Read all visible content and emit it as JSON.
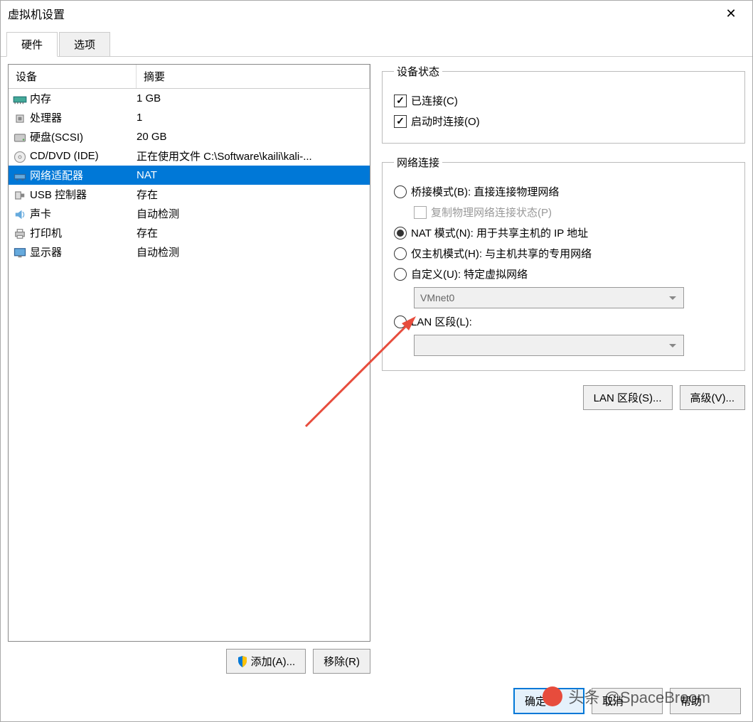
{
  "window": {
    "title": "虚拟机设置"
  },
  "tabs": {
    "hardware": "硬件",
    "options": "选项"
  },
  "list": {
    "header_device": "设备",
    "header_summary": "摘要",
    "rows": [
      {
        "icon": "memory-icon",
        "device": "内存",
        "summary": "1 GB"
      },
      {
        "icon": "cpu-icon",
        "device": "处理器",
        "summary": "1"
      },
      {
        "icon": "hdd-icon",
        "device": "硬盘(SCSI)",
        "summary": "20 GB"
      },
      {
        "icon": "cd-icon",
        "device": "CD/DVD (IDE)",
        "summary": "正在使用文件 C:\\Software\\kaili\\kali-..."
      },
      {
        "icon": "network-icon",
        "device": "网络适配器",
        "summary": "NAT",
        "selected": true
      },
      {
        "icon": "usb-icon",
        "device": "USB 控制器",
        "summary": "存在"
      },
      {
        "icon": "sound-icon",
        "device": "声卡",
        "summary": "自动检测"
      },
      {
        "icon": "printer-icon",
        "device": "打印机",
        "summary": "存在"
      },
      {
        "icon": "display-icon",
        "device": "显示器",
        "summary": "自动检测"
      }
    ]
  },
  "buttons": {
    "add": "添加(A)...",
    "remove": "移除(R)",
    "lan_segments": "LAN 区段(S)...",
    "advanced": "高级(V)...",
    "ok": "确定",
    "cancel": "取消",
    "help": "帮助"
  },
  "device_status": {
    "legend": "设备状态",
    "connected": "已连接(C)",
    "connect_on_start": "启动时连接(O)"
  },
  "network": {
    "legend": "网络连接",
    "bridged": "桥接模式(B): 直接连接物理网络",
    "replicate": "复制物理网络连接状态(P)",
    "nat": "NAT 模式(N): 用于共享主机的 IP 地址",
    "hostonly": "仅主机模式(H): 与主机共享的专用网络",
    "custom": "自定义(U): 特定虚拟网络",
    "custom_value": "VMnet0",
    "lan": "LAN 区段(L):"
  },
  "watermark": "头条 @SpaceBroom"
}
